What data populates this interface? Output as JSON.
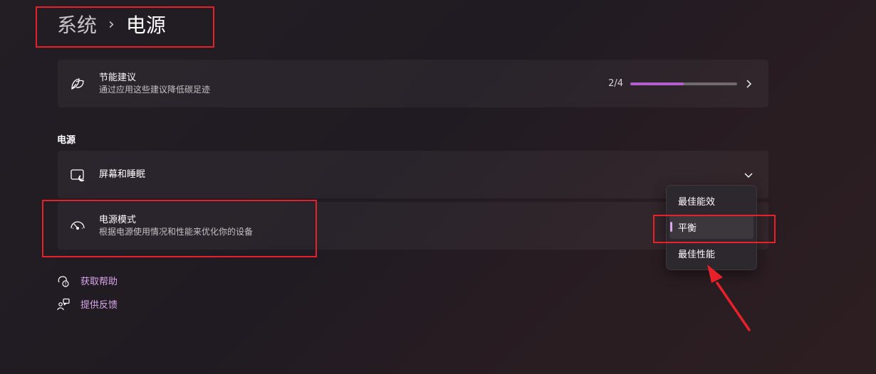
{
  "breadcrumb": {
    "parent": "系统",
    "separator": "›",
    "current": "电源"
  },
  "energy_card": {
    "title": "节能建议",
    "subtitle": "通过应用这些建议降低碳足迹",
    "progress_text": "2/4",
    "progress_fraction": 0.5,
    "icon": "leaf-icon"
  },
  "section": {
    "title": "电源"
  },
  "screen_sleep": {
    "title": "屏幕和睡眠",
    "icon": "screen-sleep-icon"
  },
  "power_mode": {
    "title": "电源模式",
    "subtitle": "根据电源使用情况和性能来优化你的设备",
    "icon": "gauge-icon"
  },
  "dropdown": {
    "options": [
      "最佳能效",
      "平衡",
      "最佳性能"
    ],
    "selected": "平衡"
  },
  "links": {
    "help": "获取帮助",
    "feedback": "提供反馈"
  },
  "colors": {
    "accent": "#d9a6ec",
    "progress": "#b35fd0",
    "annotation": "#e8202a"
  }
}
